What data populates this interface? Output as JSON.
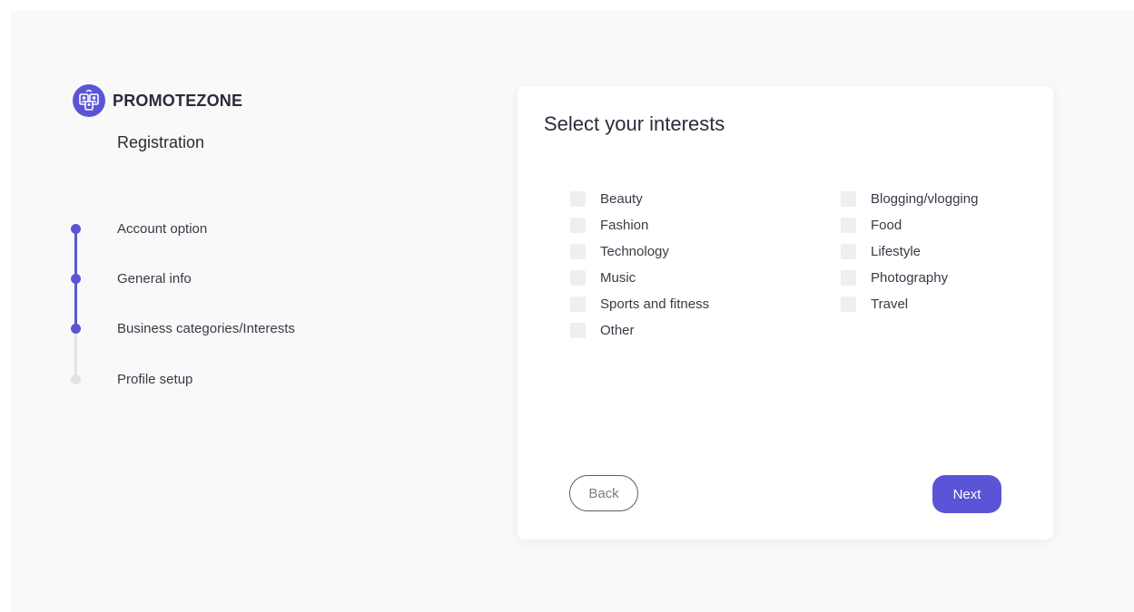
{
  "brand": {
    "name": "PROMOTEZONE",
    "subtitle": "Registration",
    "logo_icon": "people-network-icon",
    "accent": "#5a55d6"
  },
  "stepper": {
    "steps": [
      {
        "label": "Account option",
        "state": "done"
      },
      {
        "label": "General info",
        "state": "done"
      },
      {
        "label": "Business categories/Interests",
        "state": "current"
      },
      {
        "label": "Profile setup",
        "state": "pending"
      }
    ]
  },
  "card": {
    "title": "Select your interests",
    "left_options": [
      {
        "label": "Beauty",
        "checked": false
      },
      {
        "label": "Fashion",
        "checked": false
      },
      {
        "label": "Technology",
        "checked": false
      },
      {
        "label": "Music",
        "checked": false
      },
      {
        "label": "Sports and fitness",
        "checked": false
      },
      {
        "label": "Other",
        "checked": false
      }
    ],
    "right_options": [
      {
        "label": "Blogging/vlogging",
        "checked": false
      },
      {
        "label": "Food",
        "checked": false
      },
      {
        "label": "Lifestyle",
        "checked": false
      },
      {
        "label": "Photography",
        "checked": false
      },
      {
        "label": "Travel",
        "checked": false
      }
    ],
    "back_label": "Back",
    "next_label": "Next"
  }
}
